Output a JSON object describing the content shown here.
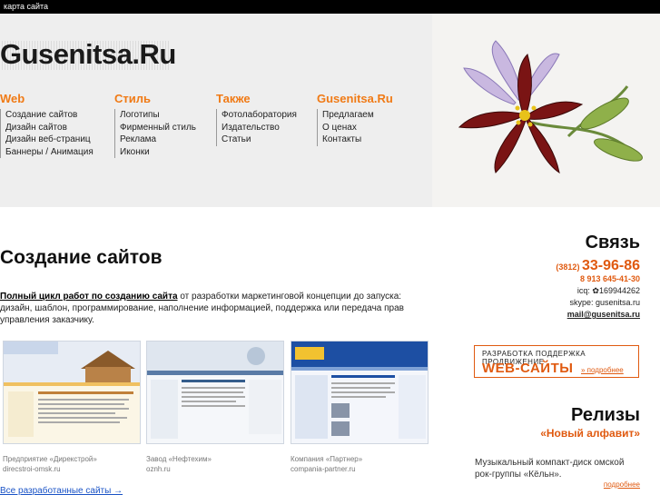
{
  "topbar": {
    "sitemap_label": "карта сайта"
  },
  "brand": {
    "logo_text": "Gusenitsa.Ru"
  },
  "menu": [
    {
      "title": "Web",
      "items": [
        "Создание сайтов",
        "Дизайн сайтов",
        "Дизайн веб-страниц",
        "Баннеры / Анимация"
      ]
    },
    {
      "title": "Стиль",
      "items": [
        "Логотипы",
        "Фирменный стиль",
        "Реклама",
        "Иконки"
      ]
    },
    {
      "title": "Также",
      "items": [
        "Фотолаборатория",
        "Издательство",
        "Статьи"
      ]
    },
    {
      "title": "Gusenitsa.Ru",
      "items": [
        "Предлагаем",
        "О ценах",
        "Контакты"
      ]
    }
  ],
  "main": {
    "title": "Создание сайтов",
    "intro_lead": "Полный цикл работ по созданию сайта",
    "intro_rest": " от разработки маркетинговой концепции до запуска: дизайн, шаблон, программирование, наполнение информацией, поддержка или передача прав управления заказчику.",
    "portfolio": [
      {
        "caption_line1": "Предприятие «Дирекстрой»",
        "caption_line2": "direcstroi-omsk.ru"
      },
      {
        "caption_line1": "Завод «Нефтехим»",
        "caption_line2": "oznh.ru"
      },
      {
        "caption_line1": "Компания «Партнер»",
        "caption_line2": "compania-partner.ru"
      }
    ],
    "all_sites_link": "Все разработанные сайты →"
  },
  "contact": {
    "heading": "Связь",
    "phone_code": "(3812)",
    "phone": "33-96-86",
    "mobile": "8 913 645-41-30",
    "icq": "icq: ✿169944262",
    "skype": "skype: gusenitsa.ru",
    "email": "mail@gusenitsa.ru"
  },
  "banner": {
    "line1": "РАЗРАБОТКА ПОДДЕРЖКА ПРОДВИЖЕНИЕ",
    "line2": "WEB-САЙТЫ",
    "more": "» подробнее"
  },
  "releases": {
    "heading": "Релизы",
    "name": "«Новый алфавит»",
    "description": "Музыкальный компакт-диск омской рок-группы «Кёльн».",
    "more": "подробнее"
  },
  "colors": {
    "accent": "#f07a15",
    "link": "#1a53c6",
    "header_bg": "#eeeeee"
  }
}
